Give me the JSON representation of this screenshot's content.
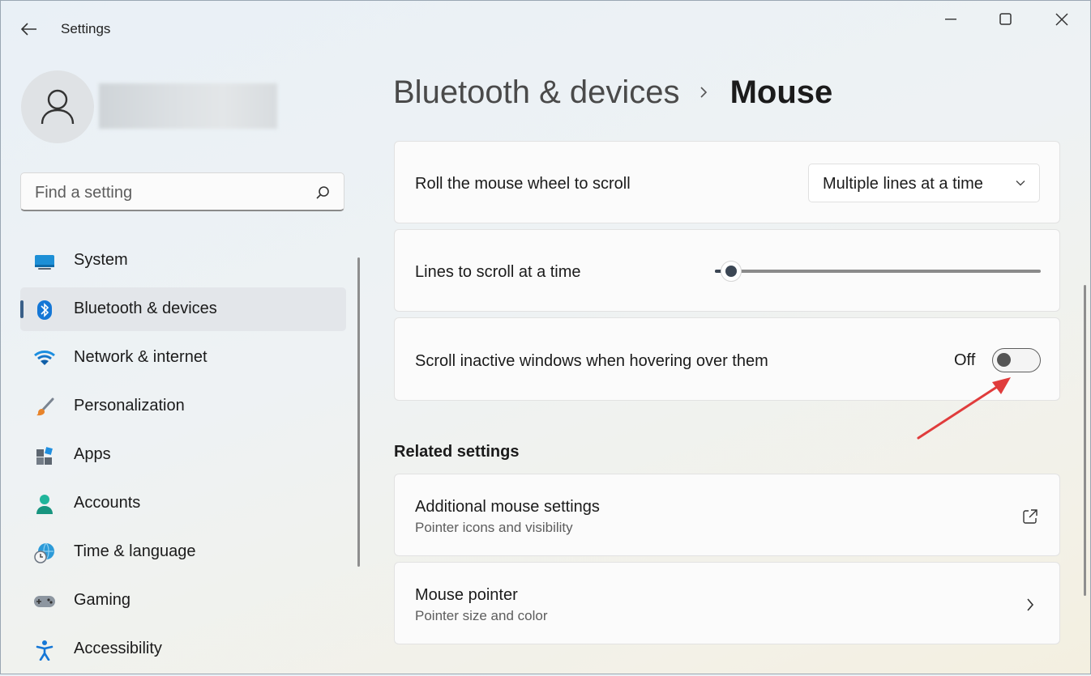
{
  "window": {
    "title": "Settings",
    "back_icon": "arrow-left-icon",
    "controls": [
      "minimize-icon",
      "maximize-icon",
      "close-icon"
    ]
  },
  "user": {
    "avatar_icon": "person-icon"
  },
  "search": {
    "placeholder": "Find a setting",
    "icon": "search-icon"
  },
  "nav": {
    "items": [
      {
        "label": "System",
        "icon": "monitor-icon"
      },
      {
        "label": "Bluetooth & devices",
        "icon": "bluetooth-icon",
        "active": true
      },
      {
        "label": "Network & internet",
        "icon": "wifi-icon"
      },
      {
        "label": "Personalization",
        "icon": "brush-icon"
      },
      {
        "label": "Apps",
        "icon": "apps-icon"
      },
      {
        "label": "Accounts",
        "icon": "account-icon"
      },
      {
        "label": "Time & language",
        "icon": "globe-clock-icon"
      },
      {
        "label": "Gaming",
        "icon": "gamepad-icon"
      },
      {
        "label": "Accessibility",
        "icon": "accessibility-icon"
      }
    ]
  },
  "breadcrumb": {
    "parent": "Bluetooth & devices",
    "current": "Mouse"
  },
  "settings": {
    "scroll_wheel": {
      "label": "Roll the mouse wheel to scroll",
      "value": "Multiple lines at a time"
    },
    "lines_to_scroll": {
      "label": "Lines to scroll at a time",
      "slider_fraction": 0.05
    },
    "scroll_inactive": {
      "label": "Scroll inactive windows when hovering over them",
      "state_text": "Off",
      "on": false
    }
  },
  "related": {
    "title": "Related settings",
    "items": [
      {
        "label": "Additional mouse settings",
        "sub": "Pointer icons and visibility",
        "icon": "external-link-icon"
      },
      {
        "label": "Mouse pointer",
        "sub": "Pointer size and color",
        "icon": "chevron-right-icon"
      }
    ]
  },
  "colors": {
    "accent": "#3b4654",
    "annotation_arrow": "#e03c3c",
    "active_indicator": "#3a5f88"
  }
}
